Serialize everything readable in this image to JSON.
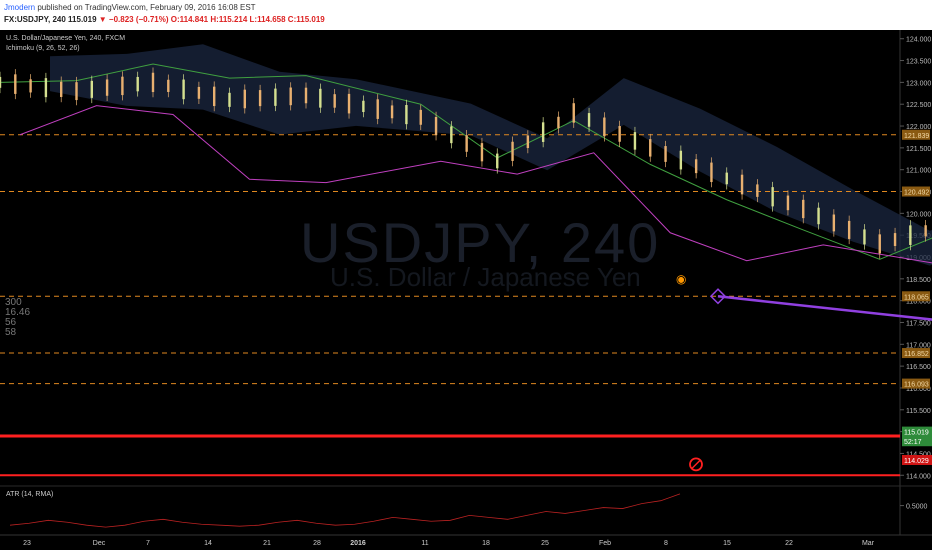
{
  "header": {
    "author": "Jmodern",
    "published": "published on TradingView.com, February 09, 2016 16:08 EST",
    "symbol": "FX:USDJPY, 240",
    "last": "115.019",
    "change": "−0.823 (−0.71%)",
    "open": "O:114.841",
    "high": "H:115.214",
    "low": "L:114.658",
    "close": "C:115.019"
  },
  "legend": {
    "title": "U.S. Dollar/Japanese Yen, 240, FXCM",
    "indicator": "Ichimoku (9, 26, 52, 26)"
  },
  "watermark": {
    "symbol": "USDJPY, 240",
    "name": "U.S. Dollar / Japanese Yen"
  },
  "stats": [
    "300",
    "16.46",
    "56",
    "58"
  ],
  "atr": {
    "label": "ATR (14, RMA)",
    "value_label": "0.5000"
  },
  "colors": {
    "background": "#000000",
    "candle_up": "#e8b070",
    "candle_down": "#d5e090",
    "tenkan": "#c040c0",
    "kijun": "#40a040",
    "cloud": "#1b2740",
    "level_line": "#e08820",
    "support_line": "#ff2020",
    "projection": "#9040e0"
  },
  "chart_data": {
    "type": "candlestick",
    "symbol": "FX:USDJPY",
    "timeframe": "240",
    "y_range": [
      113.8,
      124.2
    ],
    "y_ticks": [
      "124.000",
      "123.500",
      "123.000",
      "122.500",
      "122.000",
      "121.500",
      "121.000",
      "120.500",
      "120.000",
      "119.500",
      "119.000",
      "118.500",
      "118.000",
      "117.500",
      "117.000",
      "116.500",
      "116.000",
      "115.500",
      "115.000",
      "114.500",
      "114.000"
    ],
    "x_ticks": [
      "23",
      "Dec",
      "7",
      "14",
      "21",
      "28",
      "2016",
      "11",
      "18",
      "25",
      "Feb",
      "8",
      "15",
      "22",
      "Mar"
    ],
    "horizontal_levels": [
      {
        "price": 121.8,
        "label": "121.839"
      },
      {
        "price": 120.5,
        "label": "120.492"
      },
      {
        "price": 118.1,
        "label": "118.065"
      },
      {
        "price": 116.8,
        "label": "116.852"
      },
      {
        "price": 116.1,
        "label": "116.093"
      }
    ],
    "support_levels": [
      {
        "price": 114.9,
        "label": "115.019"
      },
      {
        "price": 114.0,
        "label": "114.029"
      }
    ],
    "price_badges": [
      {
        "price": 115.0,
        "label": "115.019",
        "color": "#2e8b3a"
      },
      {
        "price": 114.78,
        "label": "52:17",
        "color": "#2e8b3a"
      },
      {
        "price": 114.35,
        "label": "114.029",
        "color": "#d01515"
      }
    ],
    "price_path": [
      [
        0,
        123.0
      ],
      [
        10,
        122.8
      ],
      [
        20,
        123.0
      ],
      [
        30,
        122.6
      ],
      [
        40,
        122.7
      ],
      [
        55,
        122.2
      ],
      [
        65,
        121.2
      ],
      [
        75,
        122.3
      ],
      [
        85,
        121.5
      ],
      [
        95,
        120.8
      ],
      [
        105,
        120.1
      ],
      [
        115,
        119.3
      ],
      [
        125,
        119.8
      ],
      [
        135,
        118.2
      ],
      [
        145,
        117.3
      ],
      [
        155,
        117.1
      ],
      [
        160,
        117.8
      ],
      [
        170,
        117.4
      ],
      [
        180,
        118.6
      ],
      [
        190,
        118.3
      ],
      [
        200,
        117.9
      ],
      [
        210,
        118.5
      ],
      [
        215,
        121.3
      ],
      [
        222,
        120.8
      ],
      [
        228,
        119.2
      ],
      [
        233,
        118.0
      ],
      [
        238,
        117.0
      ],
      [
        242,
        116.5
      ],
      [
        248,
        115.2
      ],
      [
        252,
        114.4
      ],
      [
        256,
        115.0
      ]
    ],
    "price_x_range": [
      0,
      300
    ],
    "atr_values": [
      0.3,
      0.32,
      0.35,
      0.33,
      0.3,
      0.28,
      0.3,
      0.34,
      0.36,
      0.33,
      0.31,
      0.3,
      0.29,
      0.3,
      0.33,
      0.35,
      0.32,
      0.3,
      0.31,
      0.34,
      0.38,
      0.36,
      0.34,
      0.35,
      0.4,
      0.38,
      0.36,
      0.4,
      0.44,
      0.42,
      0.45,
      0.48,
      0.47,
      0.52,
      0.55,
      0.62
    ],
    "projection": {
      "from_price": 115.0,
      "to_price": 118.1
    }
  }
}
